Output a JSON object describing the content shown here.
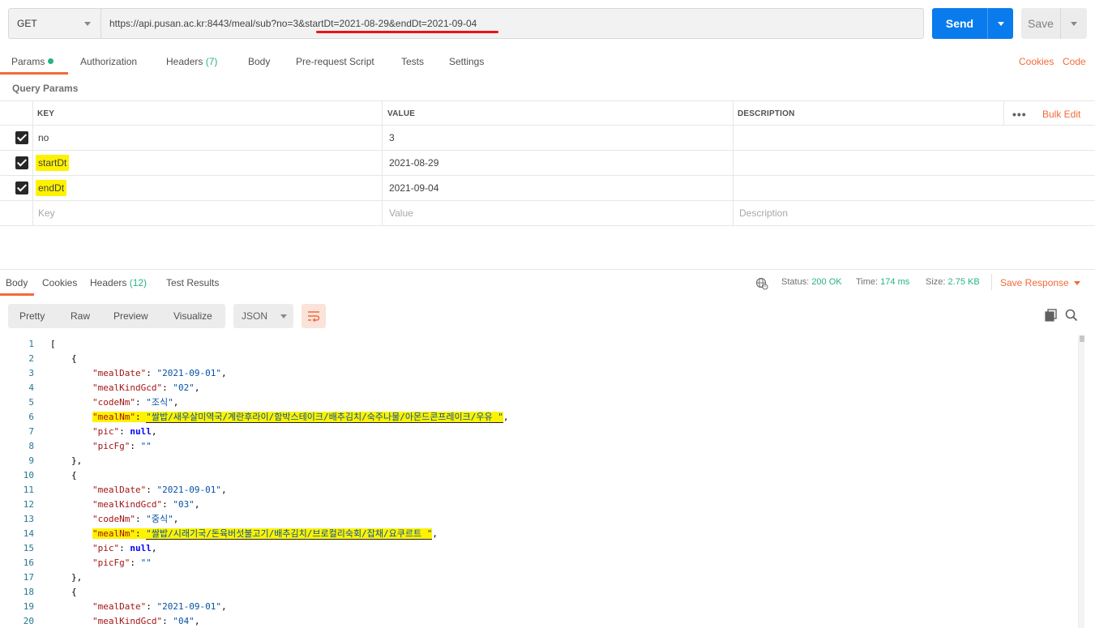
{
  "request": {
    "method": "GET",
    "url_base": "https://api.pusan.ac.kr:8443/meal/sub?no=3&",
    "url_query": "startDt=2021-08-29&endDt=2021-09-04",
    "send_label": "Send",
    "save_label": "Save"
  },
  "request_tabs": {
    "params": "Params",
    "authorization": "Authorization",
    "headers": "Headers",
    "headers_count": "(7)",
    "body": "Body",
    "prerequest": "Pre-request Script",
    "tests": "Tests",
    "settings": "Settings",
    "cookies": "Cookies",
    "code": "Code"
  },
  "query_params": {
    "section_label": "Query Params",
    "headers": {
      "key": "KEY",
      "value": "VALUE",
      "description": "DESCRIPTION",
      "bulk_edit": "Bulk Edit",
      "more": "•••"
    },
    "rows": [
      {
        "key": "no",
        "value": "3",
        "description": ""
      },
      {
        "key": "startDt",
        "value": "2021-08-29",
        "description": ""
      },
      {
        "key": "endDt",
        "value": "2021-09-04",
        "description": ""
      }
    ],
    "placeholders": {
      "key": "Key",
      "value": "Value",
      "description": "Description"
    }
  },
  "response": {
    "tabs": {
      "body": "Body",
      "cookies": "Cookies",
      "headers": "Headers",
      "headers_count": "(12)",
      "test_results": "Test Results"
    },
    "status_label": "Status:",
    "status_value": "200 OK",
    "time_label": "Time:",
    "time_value": "174 ms",
    "size_label": "Size:",
    "size_value": "2.75 KB",
    "save_response": "Save Response",
    "formats": {
      "pretty": "Pretty",
      "raw": "Raw",
      "preview": "Preview",
      "visualize": "Visualize"
    },
    "language": "JSON"
  },
  "code_lines": [
    {
      "n": "1",
      "indent": 0,
      "type": "punct",
      "text": "["
    },
    {
      "n": "2",
      "indent": 1,
      "type": "punct",
      "text": "{"
    },
    {
      "n": "3",
      "indent": 2,
      "type": "kv",
      "key": "\"mealDate\"",
      "val": "\"2021-09-01\"",
      "vtype": "s",
      "comma": ","
    },
    {
      "n": "4",
      "indent": 2,
      "type": "kv",
      "key": "\"mealKindGcd\"",
      "val": "\"02\"",
      "vtype": "s",
      "comma": ","
    },
    {
      "n": "5",
      "indent": 2,
      "type": "kv",
      "key": "\"codeNm\"",
      "val": "\"조식\"",
      "vtype": "s",
      "comma": ","
    },
    {
      "n": "6",
      "indent": 2,
      "type": "kv",
      "key": "\"mealNm\"",
      "val": "\"쌀밥/새우살미역국/계란후라이/함박스테이크/배추김치/숙주나물/아몬드콘프레이크/우유 \"",
      "vtype": "s",
      "comma": ",",
      "highlight": true
    },
    {
      "n": "7",
      "indent": 2,
      "type": "kv",
      "key": "\"pic\"",
      "val": "null",
      "vtype": "kw",
      "comma": ","
    },
    {
      "n": "8",
      "indent": 2,
      "type": "kv",
      "key": "\"picFg\"",
      "val": "\"\"",
      "vtype": "s",
      "comma": ""
    },
    {
      "n": "9",
      "indent": 1,
      "type": "punct",
      "text": "},"
    },
    {
      "n": "10",
      "indent": 1,
      "type": "punct",
      "text": "{"
    },
    {
      "n": "11",
      "indent": 2,
      "type": "kv",
      "key": "\"mealDate\"",
      "val": "\"2021-09-01\"",
      "vtype": "s",
      "comma": ","
    },
    {
      "n": "12",
      "indent": 2,
      "type": "kv",
      "key": "\"mealKindGcd\"",
      "val": "\"03\"",
      "vtype": "s",
      "comma": ","
    },
    {
      "n": "13",
      "indent": 2,
      "type": "kv",
      "key": "\"codeNm\"",
      "val": "\"중식\"",
      "vtype": "s",
      "comma": ","
    },
    {
      "n": "14",
      "indent": 2,
      "type": "kv",
      "key": "\"mealNm\"",
      "val": "\"쌀밥/시래기국/돈육버섯불고기/배추김치/브로컬리숙회/잡채/요쿠르트 \"",
      "vtype": "s",
      "comma": ",",
      "highlight": true
    },
    {
      "n": "15",
      "indent": 2,
      "type": "kv",
      "key": "\"pic\"",
      "val": "null",
      "vtype": "kw",
      "comma": ","
    },
    {
      "n": "16",
      "indent": 2,
      "type": "kv",
      "key": "\"picFg\"",
      "val": "\"\"",
      "vtype": "s",
      "comma": ""
    },
    {
      "n": "17",
      "indent": 1,
      "type": "punct",
      "text": "},"
    },
    {
      "n": "18",
      "indent": 1,
      "type": "punct",
      "text": "{"
    },
    {
      "n": "19",
      "indent": 2,
      "type": "kv",
      "key": "\"mealDate\"",
      "val": "\"2021-09-01\"",
      "vtype": "s",
      "comma": ","
    },
    {
      "n": "20",
      "indent": 2,
      "type": "kv",
      "key": "\"mealKindGcd\"",
      "val": "\"04\"",
      "vtype": "s",
      "comma": ","
    }
  ]
}
